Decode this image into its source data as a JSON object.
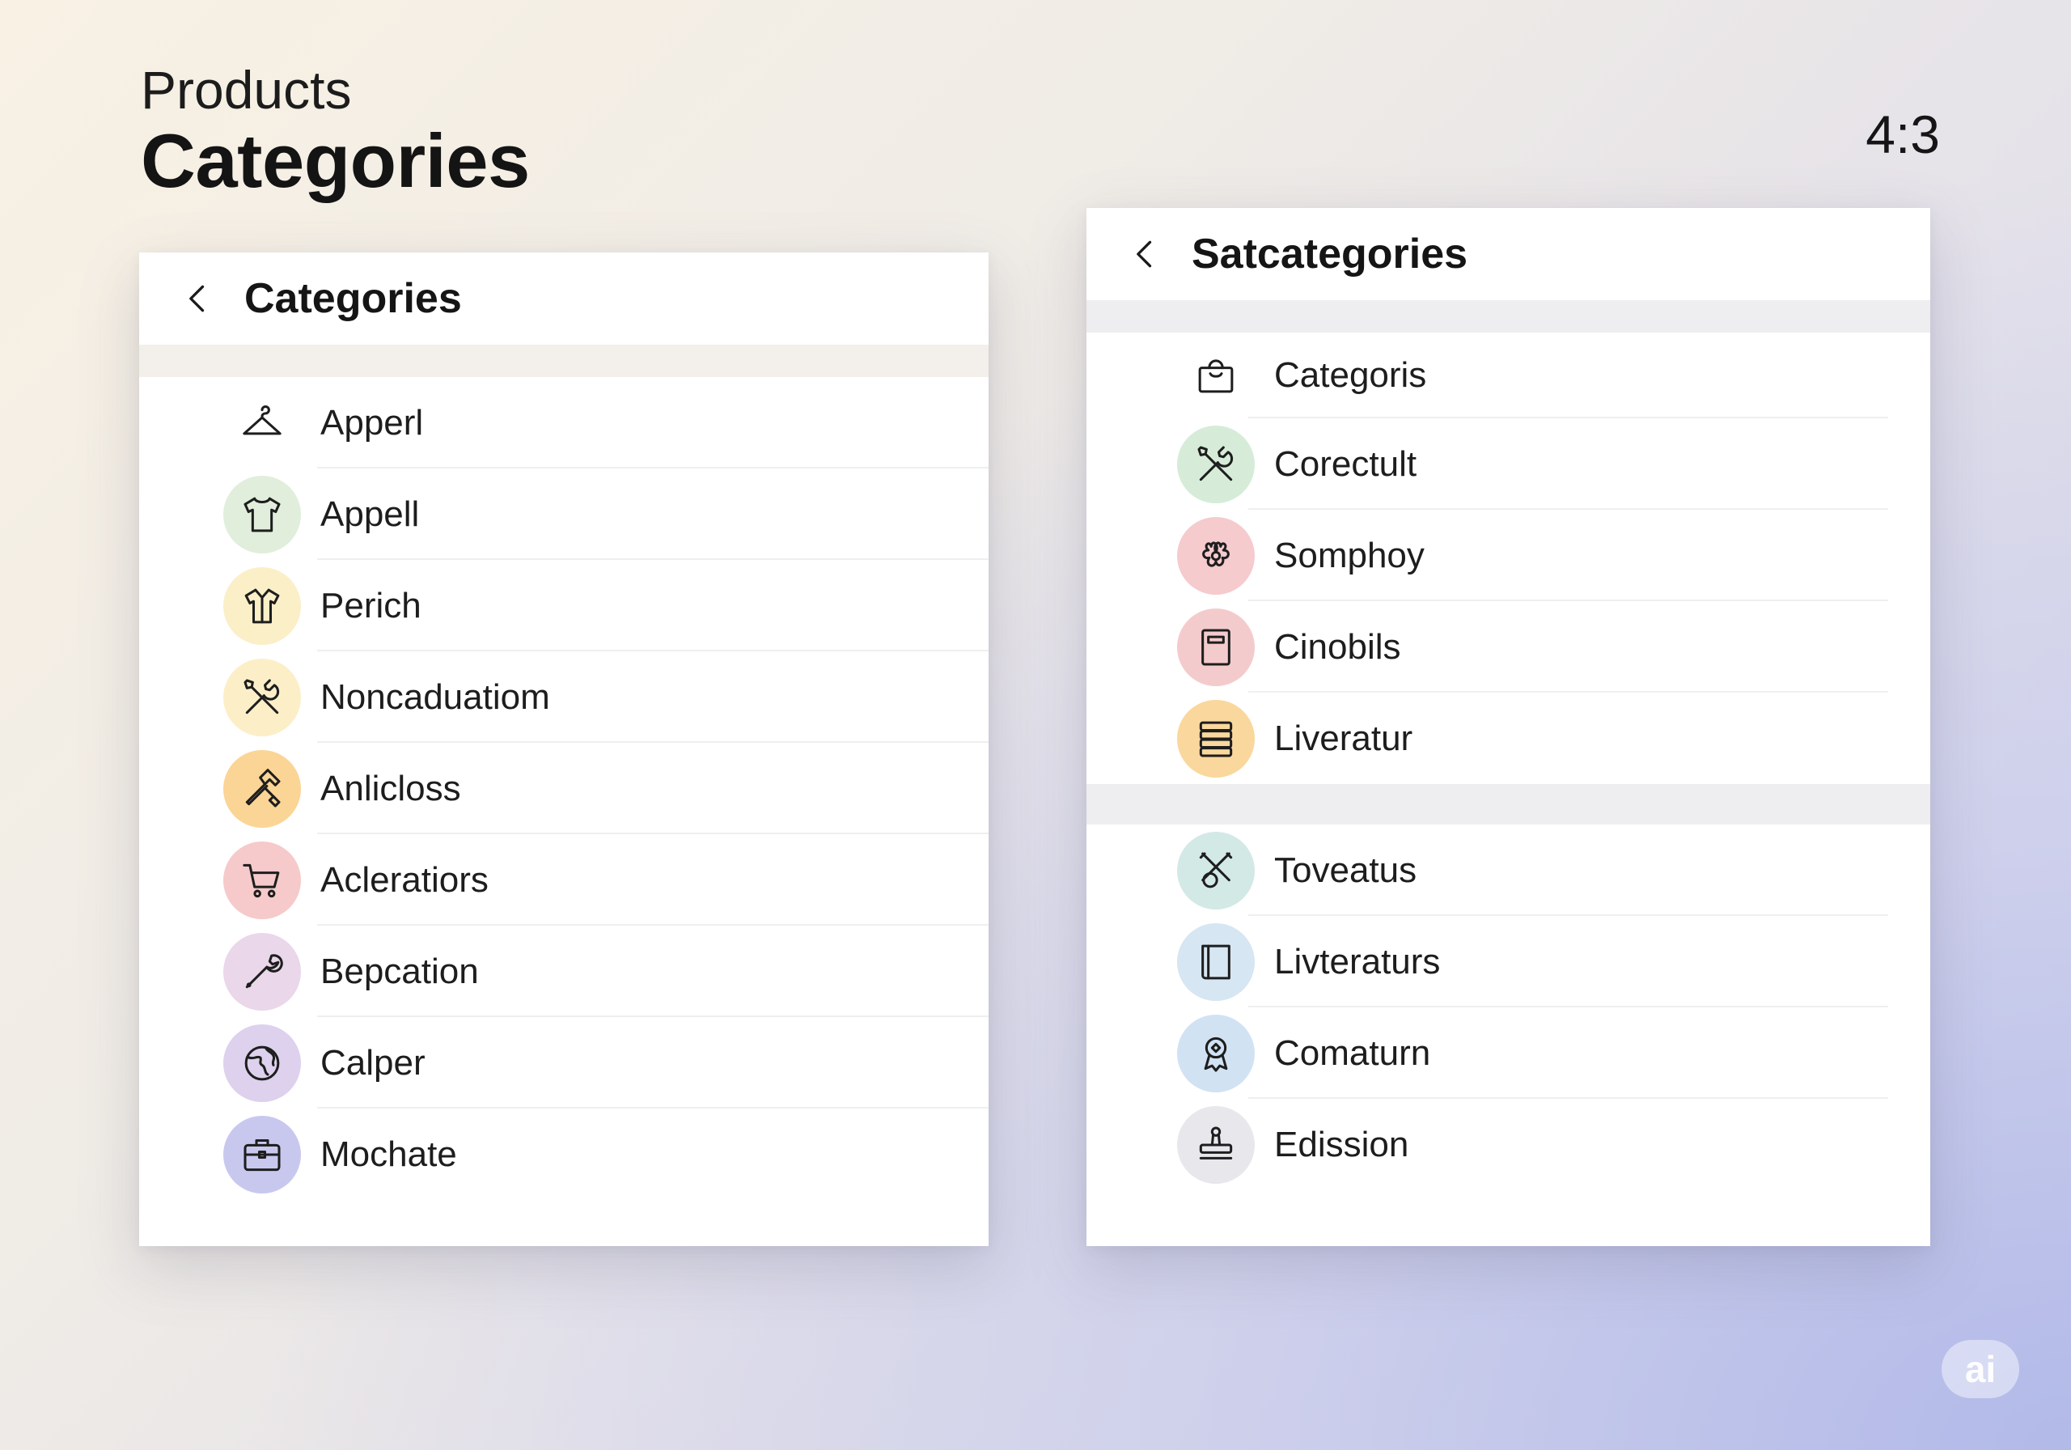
{
  "page": {
    "eyebrow": "Products",
    "title": "Categories",
    "aspect_ratio": "4:3",
    "badge": "ai"
  },
  "left_panel": {
    "title": "Categories",
    "back_icon": "chevron-left-icon",
    "items": [
      {
        "label": "Apperl",
        "icon": "hanger-icon",
        "bg": "transparent"
      },
      {
        "label": "Appell",
        "icon": "tshirt-icon",
        "bg": "#e1eedc"
      },
      {
        "label": "Perich",
        "icon": "shirt-icon",
        "bg": "#fbefc8"
      },
      {
        "label": "Noncaduatiom",
        "icon": "tools-icon",
        "bg": "#fcefc8"
      },
      {
        "label": "Anlicloss",
        "icon": "hammer-icon",
        "bg": "#fbd595"
      },
      {
        "label": "Acleratiors",
        "icon": "cart-icon",
        "bg": "#f6caca"
      },
      {
        "label": "Bepcation",
        "icon": "wrench-icon",
        "bg": "#ead7ea"
      },
      {
        "label": "Calper",
        "icon": "globe-icon",
        "bg": "#ddd1ee"
      },
      {
        "label": "Mochate",
        "icon": "briefcase-icon",
        "bg": "#c8c8ef"
      }
    ]
  },
  "right_panel": {
    "title": "Satcategories",
    "back_icon": "chevron-left-icon",
    "group_a": [
      {
        "label": "Categoris",
        "icon": "shopping-bag-icon",
        "bg": "transparent"
      },
      {
        "label": "Corectult",
        "icon": "tools-icon",
        "bg": "#d6ecd8"
      },
      {
        "label": "Somphoy",
        "icon": "flower-icon",
        "bg": "#f5cbcd"
      },
      {
        "label": "Cinobils",
        "icon": "notebook-icon",
        "bg": "#f4cbcc"
      },
      {
        "label": "Liveratur",
        "icon": "stack-icon",
        "bg": "#fad79c"
      }
    ],
    "group_b": [
      {
        "label": "Toveatus",
        "icon": "crossed-tools-icon",
        "bg": "#d3e9e6"
      },
      {
        "label": "Livteraturs",
        "icon": "book-icon",
        "bg": "#d6e6f2"
      },
      {
        "label": "Comaturn",
        "icon": "award-icon",
        "bg": "#d1e2f3"
      },
      {
        "label": "Edission",
        "icon": "stamp-icon",
        "bg": "#e8e7ec"
      }
    ]
  }
}
